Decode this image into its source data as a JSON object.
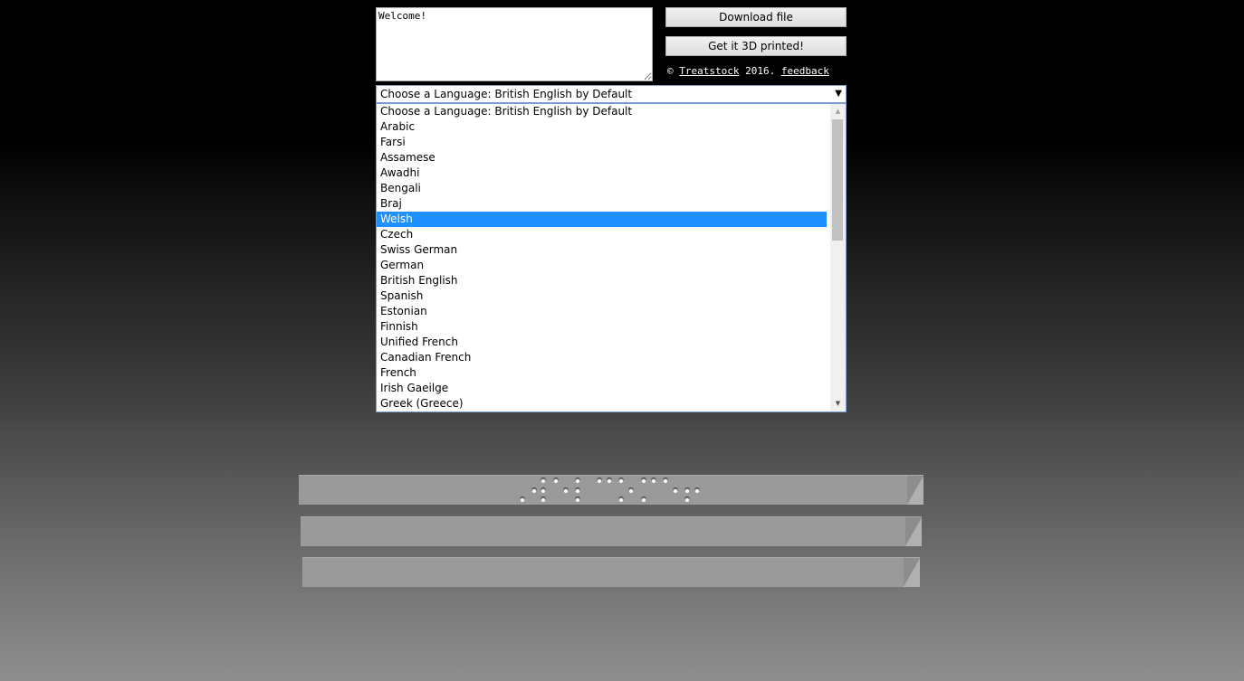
{
  "textarea": {
    "value": "Welcome!"
  },
  "buttons": {
    "download": "Download file",
    "print": "Get it 3D printed!"
  },
  "credit": {
    "copyright": "©",
    "brand": "Treatstock",
    "year": "2016.",
    "feedback": "feedback"
  },
  "language_select": {
    "selected": "Choose a Language: British English by Default",
    "highlighted": "Welsh",
    "options": [
      "Choose a Language: British English by Default",
      "Arabic",
      "Farsi",
      "Assamese",
      "Awadhi",
      "Bengali",
      "Braj",
      "Welsh",
      "Czech",
      "Swiss German",
      "German",
      "British English",
      "Spanish",
      "Estonian",
      "Finnish",
      "Unified French",
      "Canadian French",
      "French",
      "Irish Gaeilge",
      "Greek (Greece)"
    ]
  },
  "colors": {
    "highlight": "#1e90ff",
    "bar": "#9a9a9a"
  }
}
